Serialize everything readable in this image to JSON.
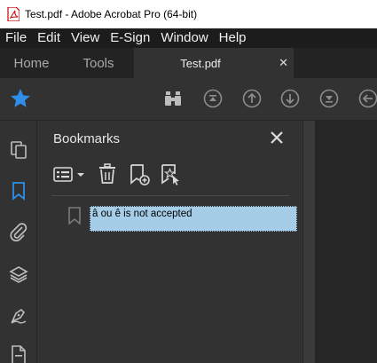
{
  "window": {
    "title": "Test.pdf - Adobe Acrobat Pro (64-bit)"
  },
  "menu": [
    "File",
    "Edit",
    "View",
    "E-Sign",
    "Window",
    "Help"
  ],
  "tabs": {
    "home": "Home",
    "tools": "Tools",
    "document": "Test.pdf",
    "close_glyph": "✕"
  },
  "panel": {
    "title": "Bookmarks",
    "bookmark_edit_value": "â ou ê is not accepted"
  },
  "colors": {
    "accent_blue": "#2e8ee8",
    "selection": "#a6cde8",
    "icon_gray": "#bdbdbd"
  },
  "icons": {
    "toolbar": [
      "star-icon",
      "find-binoculars-icon",
      "first-page-icon",
      "previous-page-icon",
      "next-page-icon",
      "last-page-icon",
      "back-icon"
    ],
    "rail": [
      "pages-icon",
      "bookmarks-icon",
      "attachments-icon",
      "layers-icon",
      "signatures-icon",
      "content-icon"
    ],
    "panel_tools": [
      "options-menu-icon",
      "delete-bookmark-icon",
      "new-bookmark-icon",
      "new-bookmark-from-structure-icon"
    ]
  }
}
